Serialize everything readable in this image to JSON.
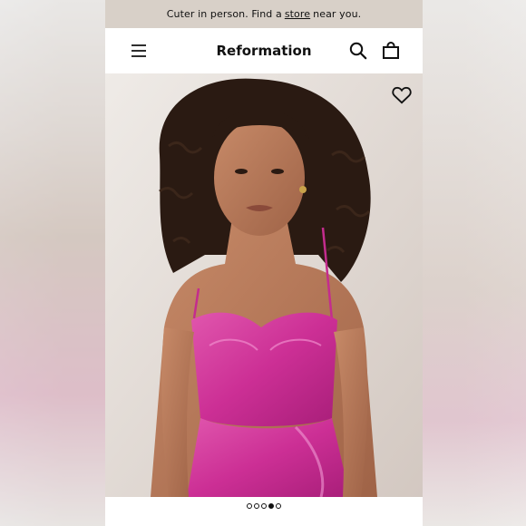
{
  "promo_bar": {
    "prefix": "Cuter in person. Find a",
    "link": "store",
    "suffix": "near you."
  },
  "nav": {
    "brand": "Reformation",
    "icons": [
      "menu-icon",
      "search-icon",
      "bag-icon"
    ]
  },
  "product_image": {
    "wishlist_icon": "heart-icon",
    "dress_color": "#d0379a"
  },
  "carousel": {
    "total": 5,
    "active_index": 3
  },
  "colors": {
    "promo_bg": "#d8d0c8",
    "text": "#111111",
    "background_wall": "#e4ddd8"
  }
}
